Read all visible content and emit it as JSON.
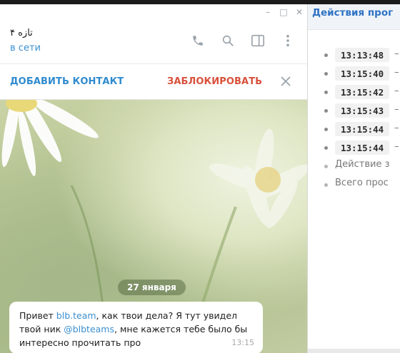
{
  "window": {
    "minimize": "–",
    "maximize": "□",
    "close": "✕"
  },
  "chat": {
    "title": "تازه ۴",
    "status": "в сети",
    "add_contact": "ДОБАВИТЬ КОНТАКТ",
    "block": "ЗАБЛОКИРОВАТЬ",
    "date": "27 января",
    "message": {
      "part1": "Привет ",
      "link1": "blb.team",
      "part2": ", как твои дела? Я тут увидел твой ник ",
      "link2": "@blbteams",
      "part3": ", мне кажется тебе было бы интересно прочитать про",
      "time": "13:15"
    }
  },
  "panel": {
    "title": "Действия прог",
    "items": [
      {
        "time": "13:13:48",
        "dash": "–"
      },
      {
        "time": "13:15:40",
        "dash": "–"
      },
      {
        "time": "13:15:42",
        "dash": "–"
      },
      {
        "time": "13:15:43",
        "dash": "–"
      },
      {
        "time": "13:15:44",
        "dash": "–"
      },
      {
        "time": "13:15:44",
        "dash": "–"
      }
    ],
    "notes": [
      "Действие з",
      "Всего прос"
    ]
  },
  "icons": [
    "phone-icon",
    "search-icon",
    "sidebar-icon",
    "more-icon",
    "close-icon"
  ]
}
